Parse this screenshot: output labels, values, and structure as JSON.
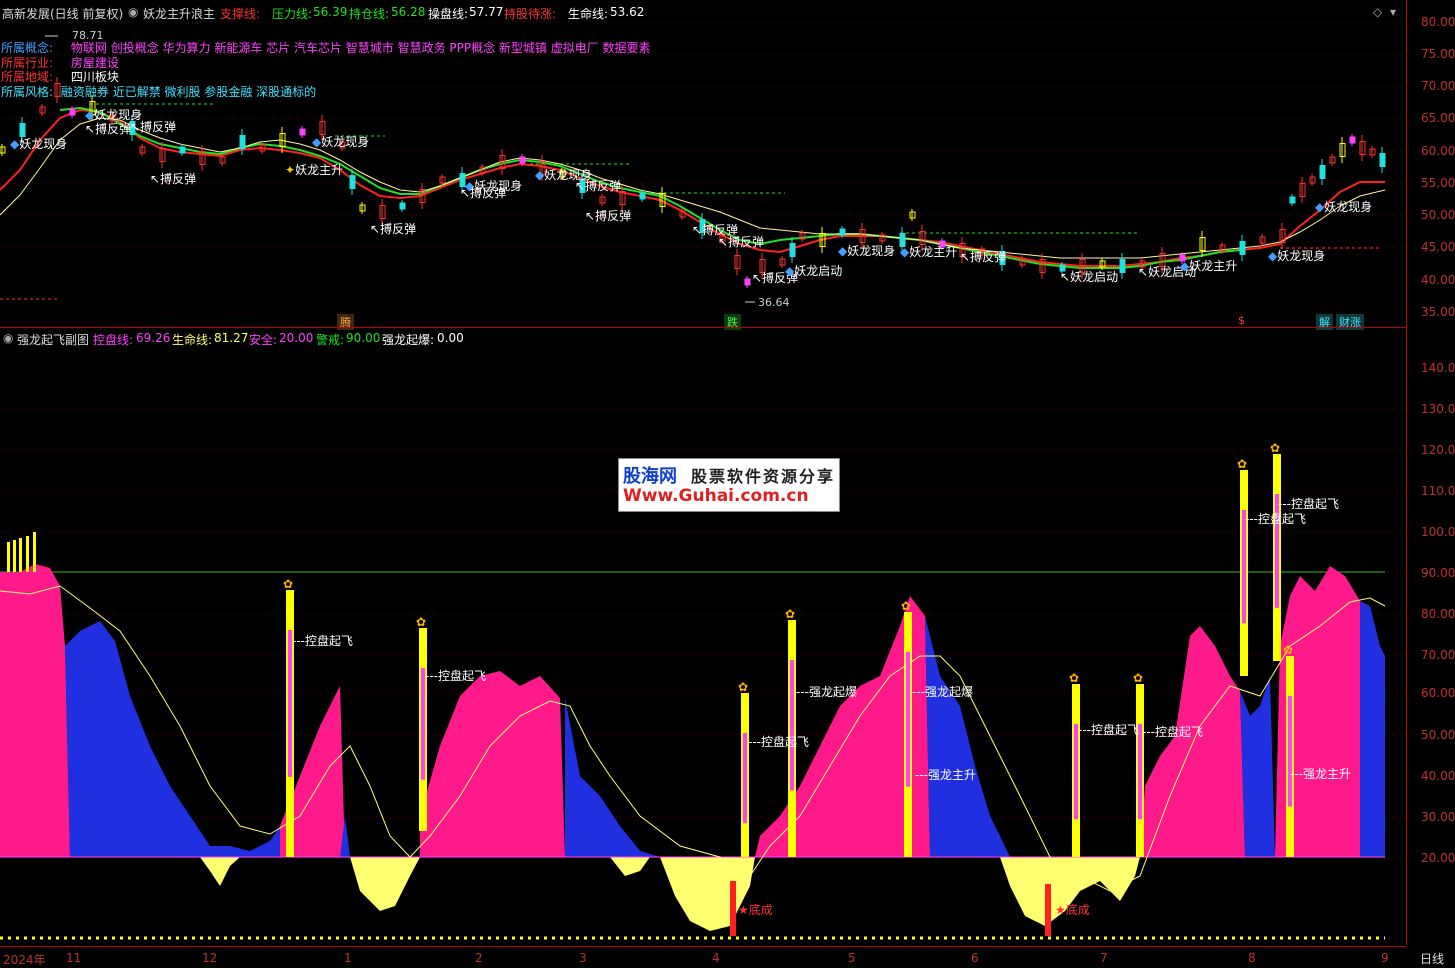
{
  "header": {
    "stock": "高新发展(日线 前复权)",
    "indicator": "妖龙主升浪主",
    "support_label": "支撑线:",
    "pressure_label": "压力线:",
    "pressure_value": "56.39",
    "hold_label": "持仓线:",
    "hold_value": "56.28",
    "operate_label": "操盘线:",
    "operate_value": "57.77",
    "wait_label": "持股待涨:",
    "life_label": "生命线:",
    "life_value": "53.62"
  },
  "info": {
    "concept_label": "所属概念:",
    "concept_value": "物联网 创投概念 华为算力 新能源车 芯片 汽车芯片 智慧城市 智慧政务 PPP概念 新型城镇 虚拟电厂 数据要素",
    "industry_label": "所属行业:",
    "industry_value": "房屋建设",
    "region_label": "所属地域:",
    "region_value": "四川板块",
    "style_label": "所属风格:",
    "style_value": "融资融券 近已解禁 微利股 参股金融 深股通标的"
  },
  "price_axis": [
    "80.00",
    "75.00",
    "70.00",
    "65.00",
    "60.00",
    "55.00",
    "50.00",
    "45.00",
    "40.00",
    "35.00"
  ],
  "sub_axis": [
    "140.0",
    "130.0",
    "120.0",
    "110.0",
    "100.0",
    "90.00",
    "80.00",
    "70.00",
    "60.00",
    "50.00",
    "40.00",
    "30.00",
    "20.00"
  ],
  "x_axis": [
    "2024年",
    "11",
    "12",
    "1",
    "2",
    "3",
    "4",
    "5",
    "6",
    "7",
    "8",
    "9"
  ],
  "period_button": "日线",
  "price_marks": {
    "high": "78.71",
    "low": "36.64"
  },
  "date_tags": [
    "腾",
    "跌",
    "$",
    "解",
    "财涨"
  ],
  "sub_header": {
    "name": "强龙起飞副图",
    "ctrl_label": "控盘线:",
    "ctrl_value": "69.26",
    "life_label": "生命线:",
    "life_value": "81.27",
    "safe_label": "安全:",
    "safe_value": "20.00",
    "warn_label": "警戒:",
    "warn_value": "90.00",
    "burst_label": "强龙起爆:",
    "burst_value": "0.00"
  },
  "price_annotations": {
    "yaolong_xianshen": "妖龙现身",
    "bo_fantan": "搏反弹",
    "yaolong_zhusheng": "妖龙主升",
    "yaolong_qidong": "妖龙启动"
  },
  "sub_annotations": {
    "kongpan": "控盘起飞",
    "qiangbao": "强龙起爆",
    "zhusheng": "强龙主升",
    "dicheng": "底成"
  },
  "watermark": {
    "brand": "股海网",
    "tagline": "股票软件资源分享",
    "url": "Www.Guhai.com.cn"
  },
  "colors": {
    "bg": "#000000",
    "axis": "#c03030",
    "magenta": "#ff1a8c",
    "blue": "#2030e0",
    "yellow": "#ffff70",
    "gold": "#ffe000",
    "green": "#20e020",
    "cyan": "#40e0ff"
  }
}
